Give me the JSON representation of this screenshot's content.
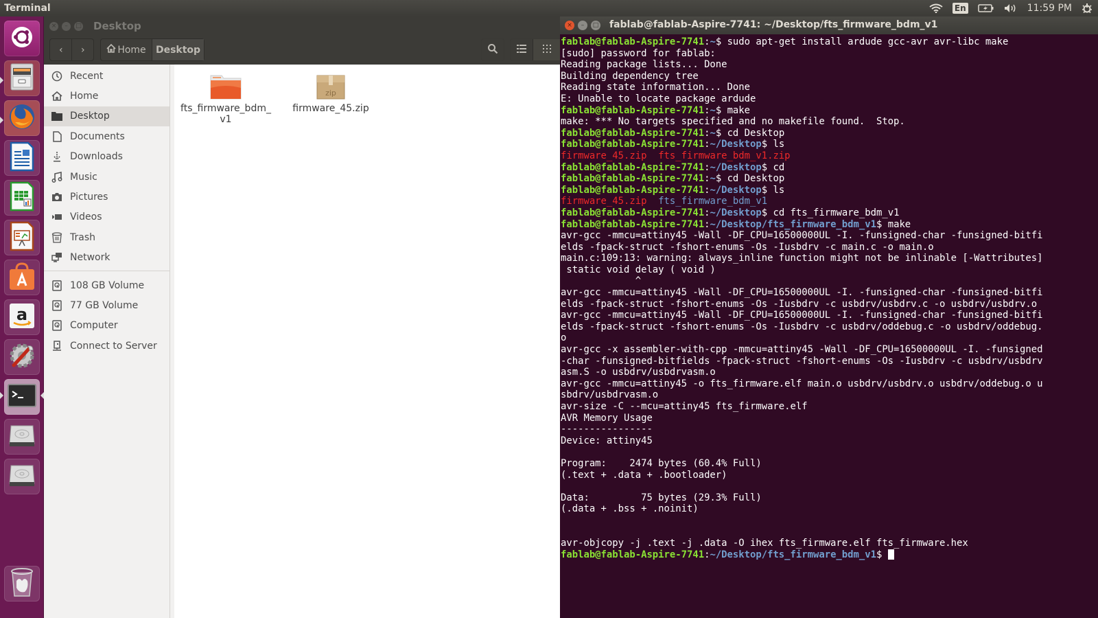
{
  "top_panel": {
    "app_title": "Terminal",
    "keyboard_layout": "En",
    "clock": "11:59 PM",
    "indicators": [
      "wifi-icon",
      "keyboard-layout-indicator",
      "battery-icon",
      "volume-icon",
      "clock",
      "power-gear-icon"
    ]
  },
  "launcher": {
    "items": [
      {
        "name": "ubuntu-dash",
        "icon": "ubuntu-logo-icon"
      },
      {
        "name": "files",
        "icon": "file-cabinet-icon",
        "running": true
      },
      {
        "name": "firefox",
        "icon": "firefox-icon",
        "running": true
      },
      {
        "name": "libreoffice-writer",
        "icon": "writer-icon"
      },
      {
        "name": "libreoffice-calc",
        "icon": "calc-icon"
      },
      {
        "name": "libreoffice-impress",
        "icon": "impress-icon"
      },
      {
        "name": "ubuntu-software",
        "icon": "software-center-icon"
      },
      {
        "name": "amazon",
        "icon": "amazon-icon"
      },
      {
        "name": "system-settings",
        "icon": "settings-icon"
      },
      {
        "name": "terminal",
        "icon": "terminal-icon",
        "running": true,
        "focused": true
      },
      {
        "name": "drive-1",
        "icon": "hard-drive-icon"
      },
      {
        "name": "drive-2",
        "icon": "hard-drive-icon"
      },
      {
        "name": "trash",
        "icon": "trash-icon"
      }
    ]
  },
  "files": {
    "window_title": "Desktop",
    "breadcrumb": {
      "home": "Home",
      "current": "Desktop"
    },
    "sidebar": {
      "places": [
        {
          "label": "Recent",
          "icon": "clock-icon"
        },
        {
          "label": "Home",
          "icon": "home-icon"
        },
        {
          "label": "Desktop",
          "icon": "folder-icon",
          "active": true
        },
        {
          "label": "Documents",
          "icon": "document-icon"
        },
        {
          "label": "Downloads",
          "icon": "download-icon"
        },
        {
          "label": "Music",
          "icon": "music-icon"
        },
        {
          "label": "Pictures",
          "icon": "camera-icon"
        },
        {
          "label": "Videos",
          "icon": "video-icon"
        },
        {
          "label": "Trash",
          "icon": "trash-icon"
        },
        {
          "label": "Network",
          "icon": "network-icon"
        }
      ],
      "devices": [
        {
          "label": "108 GB Volume",
          "icon": "drive-icon"
        },
        {
          "label": "77 GB Volume",
          "icon": "drive-icon"
        },
        {
          "label": "Computer",
          "icon": "drive-icon"
        },
        {
          "label": "Connect to Server",
          "icon": "server-icon"
        }
      ]
    },
    "items": [
      {
        "name_line1": "fts_firmware_bdm_",
        "name_line2": "v1",
        "type": "folder"
      },
      {
        "name_line1": "firmware_45.zip",
        "name_line2": "",
        "type": "zip",
        "badge": "zip"
      }
    ]
  },
  "terminal": {
    "window_title": "fablab@fablab-Aspire-7741: ~/Desktop/fts_firmware_bdm_v1",
    "prompt_user": "fablab@fablab-Aspire-7741",
    "lines": [
      {
        "type": "prompt",
        "path": "~",
        "cmd": " sudo apt-get install ardude gcc-avr avr-libc make"
      },
      {
        "type": "out",
        "text": "[sudo] password for fablab:"
      },
      {
        "type": "out",
        "text": "Reading package lists... Done"
      },
      {
        "type": "out",
        "text": "Building dependency tree"
      },
      {
        "type": "out",
        "text": "Reading state information... Done"
      },
      {
        "type": "out",
        "text": "E: Unable to locate package ardude"
      },
      {
        "type": "prompt",
        "path": "~",
        "cmd": " make"
      },
      {
        "type": "out",
        "text": "make: *** No targets specified and no makefile found.  Stop."
      },
      {
        "type": "prompt",
        "path": "~",
        "cmd": " cd Desktop"
      },
      {
        "type": "prompt",
        "path": "~/Desktop",
        "cmd": " ls"
      },
      {
        "type": "ls",
        "items": [
          {
            "text": "firmware_45.zip",
            "color": "red"
          },
          {
            "text": "fts_firmware_bdm_v1.zip",
            "color": "red"
          }
        ]
      },
      {
        "type": "prompt",
        "path": "~/Desktop",
        "cmd": " cd"
      },
      {
        "type": "prompt",
        "path": "~",
        "cmd": " cd Desktop"
      },
      {
        "type": "prompt",
        "path": "~/Desktop",
        "cmd": " ls"
      },
      {
        "type": "ls",
        "items": [
          {
            "text": "firmware_45.zip",
            "color": "red"
          },
          {
            "text": "fts_firmware_bdm_v1",
            "color": "blue"
          }
        ]
      },
      {
        "type": "prompt",
        "path": "~/Desktop",
        "cmd": " cd fts_firmware_bdm_v1"
      },
      {
        "type": "prompt",
        "path": "~/Desktop/fts_firmware_bdm_v1",
        "cmd": " make"
      },
      {
        "type": "out",
        "text": "avr-gcc -mmcu=attiny45 -Wall -DF_CPU=16500000UL -I. -funsigned-char -funsigned-bitfi"
      },
      {
        "type": "out",
        "text": "elds -fpack-struct -fshort-enums -Os -Iusbdrv -c main.c -o main.o"
      },
      {
        "type": "out",
        "text": "main.c:109:13: warning: always_inline function might not be inlinable [-Wattributes]"
      },
      {
        "type": "out",
        "text": " static void delay ( void )"
      },
      {
        "type": "out",
        "text": "             ^"
      },
      {
        "type": "out",
        "text": "avr-gcc -mmcu=attiny45 -Wall -DF_CPU=16500000UL -I. -funsigned-char -funsigned-bitfi"
      },
      {
        "type": "out",
        "text": "elds -fpack-struct -fshort-enums -Os -Iusbdrv -c usbdrv/usbdrv.c -o usbdrv/usbdrv.o"
      },
      {
        "type": "out",
        "text": "avr-gcc -mmcu=attiny45 -Wall -DF_CPU=16500000UL -I. -funsigned-char -funsigned-bitfi"
      },
      {
        "type": "out",
        "text": "elds -fpack-struct -fshort-enums -Os -Iusbdrv -c usbdrv/oddebug.c -o usbdrv/oddebug."
      },
      {
        "type": "out",
        "text": "o"
      },
      {
        "type": "out",
        "text": "avr-gcc -x assembler-with-cpp -mmcu=attiny45 -Wall -DF_CPU=16500000UL -I. -funsigned"
      },
      {
        "type": "out",
        "text": "-char -funsigned-bitfields -fpack-struct -fshort-enums -Os -Iusbdrv -c usbdrv/usbdrv"
      },
      {
        "type": "out",
        "text": "asm.S -o usbdrv/usbdrvasm.o"
      },
      {
        "type": "out",
        "text": "avr-gcc -mmcu=attiny45 -o fts_firmware.elf main.o usbdrv/usbdrv.o usbdrv/oddebug.o u"
      },
      {
        "type": "out",
        "text": "sbdrv/usbdrvasm.o"
      },
      {
        "type": "out",
        "text": "avr-size -C --mcu=attiny45 fts_firmware.elf"
      },
      {
        "type": "out",
        "text": "AVR Memory Usage"
      },
      {
        "type": "out",
        "text": "----------------"
      },
      {
        "type": "out",
        "text": "Device: attiny45"
      },
      {
        "type": "out",
        "text": ""
      },
      {
        "type": "out",
        "text": "Program:    2474 bytes (60.4% Full)"
      },
      {
        "type": "out",
        "text": "(.text + .data + .bootloader)"
      },
      {
        "type": "out",
        "text": ""
      },
      {
        "type": "out",
        "text": "Data:         75 bytes (29.3% Full)"
      },
      {
        "type": "out",
        "text": "(.data + .bss + .noinit)"
      },
      {
        "type": "out",
        "text": ""
      },
      {
        "type": "out",
        "text": ""
      },
      {
        "type": "out",
        "text": "avr-objcopy -j .text -j .data -O ihex fts_firmware.elf fts_firmware.hex"
      },
      {
        "type": "prompt",
        "path": "~/Desktop/fts_firmware_bdm_v1",
        "cmd": " ",
        "cursor": true
      }
    ]
  },
  "colors": {
    "terminal_bg": "#300a24",
    "prompt_user": "#8ae234",
    "prompt_path": "#729fcf",
    "archive_red": "#ef2929",
    "launcher_bg": "#6b1a52",
    "panel_bg": "#3c3b37"
  }
}
